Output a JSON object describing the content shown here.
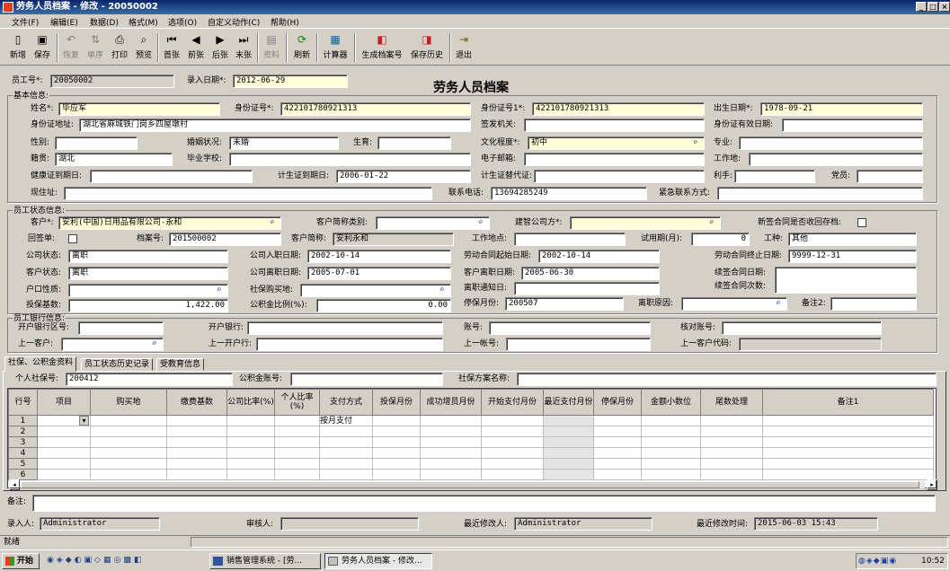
{
  "window": {
    "title": "劳务人员档案 - 修改 - 20050002",
    "min": "_",
    "max": "□",
    "close": "×"
  },
  "menu": [
    "文件(F)",
    "编辑(E)",
    "数据(D)",
    "格式(M)",
    "选项(O)",
    "自定义动作(C)",
    "帮助(H)"
  ],
  "toolbar": [
    {
      "label": "新增",
      "icon": "new-doc-icon",
      "glyph": "▯",
      "enabled": true
    },
    {
      "label": "保存",
      "icon": "save-icon",
      "glyph": "▣",
      "enabled": true
    },
    {
      "label": "恢复",
      "icon": "undo-icon",
      "glyph": "↶",
      "enabled": false
    },
    {
      "label": "单序",
      "icon": "sort-icon",
      "glyph": "⇅",
      "enabled": false
    },
    {
      "label": "打印",
      "icon": "print-icon",
      "glyph": "⎙",
      "enabled": true
    },
    {
      "label": "预览",
      "icon": "preview-icon",
      "glyph": "⌕",
      "enabled": true
    },
    {
      "label": "首张",
      "icon": "first-icon",
      "glyph": "⏮",
      "enabled": true
    },
    {
      "label": "前张",
      "icon": "prev-icon",
      "glyph": "◀",
      "enabled": true
    },
    {
      "label": "后张",
      "icon": "next-icon",
      "glyph": "▶",
      "enabled": true
    },
    {
      "label": "末张",
      "icon": "last-icon",
      "glyph": "⏭",
      "enabled": true
    },
    {
      "label": "资料",
      "icon": "info-icon",
      "glyph": "▤",
      "enabled": false
    },
    {
      "label": "刷新",
      "icon": "refresh-icon",
      "glyph": "⟳",
      "enabled": true
    },
    {
      "label": "计算器",
      "icon": "calculator-icon",
      "glyph": "▦",
      "enabled": true
    },
    {
      "label": "生成档案号",
      "icon": "generate-icon",
      "glyph": "◧",
      "enabled": true
    },
    {
      "label": "保存历史",
      "icon": "history-icon",
      "glyph": "◨",
      "enabled": true
    },
    {
      "label": "退出",
      "icon": "exit-icon",
      "glyph": "⇥",
      "enabled": true
    }
  ],
  "header": {
    "emp_no_label": "员工号*:",
    "emp_no": "20050002",
    "entry_date_label": "录入日期*:",
    "entry_date": "2012-06-29",
    "title": "劳务人员档案"
  },
  "basic": {
    "group": "基本信息:",
    "name_label": "姓名*:",
    "name": "毕应军",
    "id_label": "身份证号*:",
    "id": "422101780921313",
    "id1_label": "身份证号1*:",
    "id1": "422101780921313",
    "birth_label": "出生日期*:",
    "birth": "1978-09-21",
    "addr_label": "身份证地址:",
    "addr": "湖北省麻城铁门岗乡四屋墩村",
    "issuer_label": "签发机关:",
    "issuer": "",
    "valid_label": "身份证有效日期:",
    "valid": "",
    "gender_label": "性别:",
    "gender": "",
    "marital_label": "婚姻状况:",
    "marital": "未婚",
    "birthstatus_label": "生育:",
    "birthstatus": "",
    "edu_label": "文化程度*:",
    "edu": "初中",
    "major_label": "专业:",
    "major": "",
    "native_label": "籍贯:",
    "native": "湖北",
    "school_label": "毕业学校:",
    "school": "",
    "email_label": "电子邮箱:",
    "email": "",
    "workplace_label": "工作地:",
    "workplace": "",
    "health_label": "健康证到期日:",
    "health": "",
    "planbirth_label": "计生证到期日:",
    "planbirth": "2006-01-22",
    "planbirth_sub_label": "计生证替代证:",
    "planbirth_sub": "",
    "lefty_label": "利手:",
    "lefty": "",
    "party_label": "党员:",
    "party": "",
    "curaddr_label": "现住址:",
    "curaddr": "",
    "phone_label": "联系电话:",
    "phone": "13694285249",
    "emergency_label": "紧急联系方式:",
    "emergency": ""
  },
  "status": {
    "group": "员工状态信息:",
    "customer_label": "客户*:",
    "customer": "安利(中国)日用品有限公司-永和",
    "custtype_label": "客户简称类别:",
    "custtype": "",
    "buildco_label": "建智公司方*:",
    "buildco": "",
    "newcontract_label": "新签合同是否收回存档:",
    "returnform_label": "回签单:",
    "fileno_label": "档案号:",
    "fileno": "201500002",
    "custabbr_label": "客户简称:",
    "custabbr": "安利永和",
    "worksite_label": "工作地点:",
    "worksite": "",
    "probation_label": "试用期(月):",
    "probation": "0",
    "jobtype_label": "工种:",
    "jobtype": "其他",
    "cstate_label": "公司状态:",
    "cstate": "离职",
    "cjoin_label": "公司入职日期:",
    "cjoin": "2002-10-14",
    "lstart_label": "劳动合同起始日期:",
    "lstart": "2002-10-14",
    "lend_label": "劳动合同终止日期:",
    "lend": "9999-12-31",
    "custstate_label": "客户状态:",
    "custstate": "离职",
    "cleave_label": "公司离职日期:",
    "cleave": "2005-07-01",
    "custleave_label": "客户离职日期:",
    "custleave": "2005-06-30",
    "renew_date_label": "续签合同日期:",
    "renew_count_label": "续签合同次数:",
    "hukou_label": "户口性质:",
    "hukou": "",
    "ssplace_label": "社保购买地:",
    "ssplace": "",
    "leavenotice_label": "离职通知日:",
    "leavenotice": "",
    "base_label": "投保基数:",
    "base": "1,422.00",
    "fundratio_label": "公积金比例(%):",
    "fundratio": "0.00",
    "stopmonth_label": "停保月份:",
    "stopmonth": "200507",
    "leavereason_label": "离职原因:",
    "leavereason": "",
    "remark2_label": "备注2:",
    "remark2": ""
  },
  "bank": {
    "group": "员工银行信息:",
    "bankarea_label": "开户银行区号:",
    "bankarea": "",
    "bank_label": "开户银行:",
    "bank": "",
    "acct_label": "账号:",
    "acct": "",
    "checkacct_label": "核对账号:",
    "checkacct": "",
    "prevcust_label": "上一客户:",
    "prevcust": "",
    "prevbank_label": "上一开户行:",
    "prevbank": "",
    "prevacct_label": "上一帐号:",
    "prevacct": "",
    "prevcustcode_label": "上一客户代码:",
    "prevcustcode": ""
  },
  "tabs": [
    "社保、公积金资料",
    "员工状态历史记录",
    "受教育信息"
  ],
  "insurance": {
    "ssno_label": "个人社保号:",
    "ssno": "200412",
    "fundno_label": "公积金账号:",
    "fundno": "",
    "plan_label": "社保方案名称:",
    "plan": ""
  },
  "grid": {
    "columns": [
      "行号",
      "项目",
      "购买地",
      "缴费基数",
      "公司比率(%)",
      "个人比率(%)",
      "支付方式",
      "投保月份",
      "成功增员月份",
      "开始支付月份",
      "最近支付月份",
      "停保月份",
      "金额小数位",
      "尾数处理",
      "备注1"
    ],
    "rows": [
      [
        "1",
        "",
        "",
        "",
        "",
        "",
        "按月支付",
        "",
        "",
        "",
        "",
        "",
        "",
        "",
        ""
      ],
      [
        "2",
        "",
        "",
        "",
        "",
        "",
        "",
        "",
        "",
        "",
        "",
        "",
        "",
        "",
        ""
      ],
      [
        "3",
        "",
        "",
        "",
        "",
        "",
        "",
        "",
        "",
        "",
        "",
        "",
        "",
        "",
        ""
      ],
      [
        "4",
        "",
        "",
        "",
        "",
        "",
        "",
        "",
        "",
        "",
        "",
        "",
        "",
        "",
        ""
      ],
      [
        "5",
        "",
        "",
        "",
        "",
        "",
        "",
        "",
        "",
        "",
        "",
        "",
        "",
        "",
        ""
      ],
      [
        "6",
        "",
        "",
        "",
        "",
        "",
        "",
        "",
        "",
        "",
        "",
        "",
        "",
        "",
        ""
      ]
    ]
  },
  "footer": {
    "remark_label": "备注:",
    "remark": "",
    "creator_label": "录入人:",
    "creator": "Administrator",
    "reviewer_label": "审核人:",
    "reviewer": "",
    "modifier_label": "最近修改人:",
    "modifier": "Administrator",
    "modtime_label": "最近修改时间:",
    "modtime": "2015-06-03 15:43"
  },
  "statusbar": "就绪",
  "taskbar": {
    "start": "开始",
    "task1": "销售管理系统 - [劳...",
    "task2": "劳务人员档案 - 修改...",
    "clock": "10:52"
  }
}
